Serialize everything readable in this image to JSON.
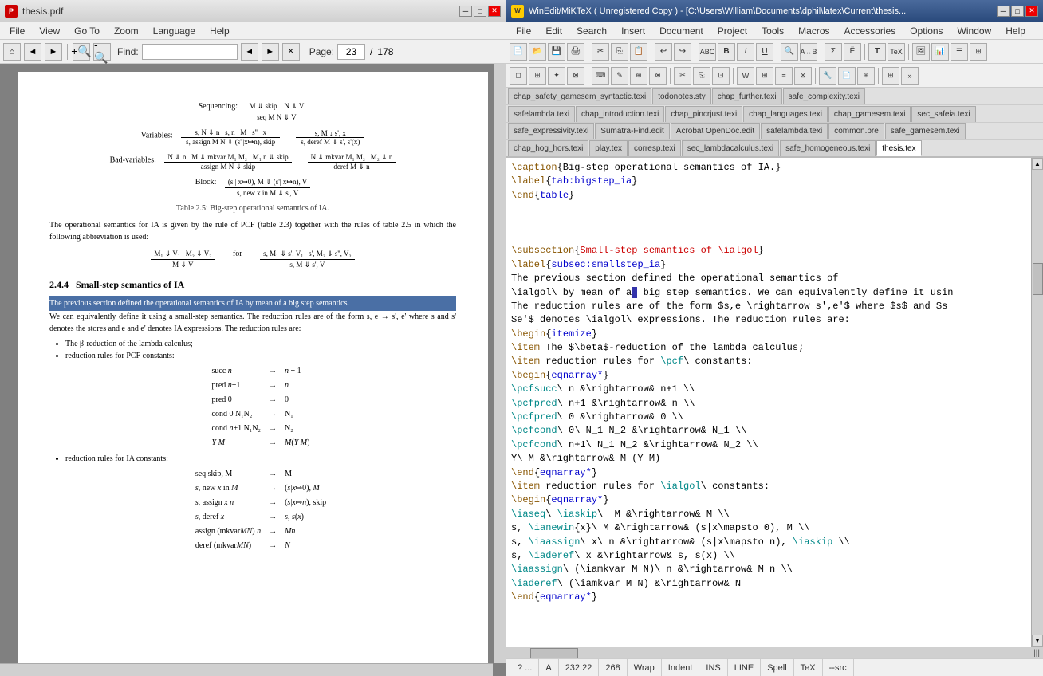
{
  "pdf": {
    "title": "thesis.pdf",
    "menubar": [
      "File",
      "View",
      "Go To",
      "Zoom",
      "Language",
      "Help"
    ],
    "toolbar": {
      "find_label": "Find:",
      "find_value": "",
      "page_current": "23",
      "page_total": "178"
    },
    "content": {
      "section": "2.4.4  Small-step semantics of IA",
      "table_caption": "Table 2.5: Big-step operational semantics of IA.",
      "highlight_text": "The previous section defined the operational semantics of IA by mean of a big step semantics.",
      "sub_text": "We can equivalently define it using a small-step semantics. The reduction rules are of the form s, e → s', e' where s and s' denotes the stores and e and e' denotes IA expressions. The reduction rules are:",
      "bullets": [
        "The β-reduction of the lambda calculus;",
        "reduction rules for PCF constants:",
        "reduction rules for IA constants:"
      ],
      "pcf_rules": [
        "succ n  →  n + 1",
        "pred n+1  →  n",
        "pred 0  →  0",
        "cond 0 N₁N₂  →  N₁",
        "cond n+1 N₁N₂  →  N₂",
        "Y M  →  M(YM)"
      ],
      "ia_rules": [
        "seq skip, M  →  M",
        "s, new x in M  →  (s|x↦0), M",
        "s, assign x n  →  (s|x↦n), skip",
        "s, deref x  →  s, s(x)",
        "assign (mkvar MN) n  →  M n",
        "deref (mkvar MN)  →  N"
      ]
    }
  },
  "editor": {
    "title": "WinEdit/MiKTeX  ( Unregistered Copy )  - [C:\\Users\\William\\Documents\\dphil\\latex\\Current\\thesis...",
    "menubar": [
      "File",
      "Edit",
      "Search",
      "Insert",
      "Document",
      "Project",
      "Tools",
      "Macros",
      "Accessories",
      "Options",
      "Window",
      "Help"
    ],
    "tabs_row1": [
      "chap_safety_gamesem_syntactic.texi",
      "todonotes.sty",
      "chap_further.texi",
      "safe_complexity.texi"
    ],
    "tabs_row2": [
      "safelambda.texi",
      "chap_introduction.texi",
      "chap_pincrjust.texi",
      "chap_languages.texi",
      "chap_gamesem.texi",
      "sec_safeia.texi"
    ],
    "tabs_row3": [
      "safe_expressivity.texi",
      "Sumatra-Find.edit",
      "Acrobat OpenDoc.edit",
      "safelambda.texi",
      "common.pre",
      "safe_gamesem.texi"
    ],
    "tabs_row4": [
      "chap_hog_hors.texi",
      "play.tex",
      "corresp.texi",
      "sec_lambdacalculus.texi",
      "safe_homogeneous.texi",
      "thesis.tex"
    ],
    "active_tab": "thesis.tex",
    "code_lines": [
      "\\caption{Big-step operational semantics of IA.}",
      "\\label{tab:bigstep_ia}",
      "\\end{table}",
      "",
      "",
      "\\subsection{Small-step semantics of \\ialgol}",
      "\\label{subsec:smallstep_ia}",
      "The previous section defined the operational semantics of",
      "\\ialgol\\ by mean of a big step semantics. We can equivalently define it usin",
      "The reduction rules are of the form $s,e \\rightarrow s',e'$ where $s$ and $s",
      "$e'$ denotes \\ialgol\\ expressions. The reduction rules are:",
      "\\begin{itemize}",
      "\\item The $\\beta$-reduction of the lambda calculus;",
      "\\item reduction rules for \\pcf\\ constants:",
      "\\begin{eqnarray*}",
      "\\pcfsucc\\ n &\\rightarrow& n+1 \\\\",
      "\\pcfpred\\ n+1 &\\rightarrow& n \\\\",
      "\\pcfpred\\ 0 &\\rightarrow& 0 \\\\",
      "\\pcfcond\\ 0\\ N_1 N_2 &\\rightarrow& N_1 \\\\",
      "\\pcfcond\\ n+1\\ N_1 N_2 &\\rightarrow& N_2 \\\\",
      "Y\\ M &\\rightarrow& M (Y M)",
      "\\end{eqnarray*}",
      "\\item reduction rules for \\ialgol\\ constants:",
      "\\begin{eqnarray*}",
      "\\iaseq\\ \\iaskip\\  M &\\rightarrow& M \\\\",
      "s, \\ianewin{x}\\ M &\\rightarrow& (s|x\\mapsto 0), M \\\\",
      "s, \\iaassign\\ x\\ n &\\rightarrow& (s|x\\mapsto n), \\iaskip \\\\",
      "s, \\iaderef\\ x &\\rightarrow& s, s(x) \\\\",
      "\\iaassign\\ (\\iamkvar M N)\\ n &\\rightarrow& M n \\\\",
      "\\iaderef\\ (\\iamkvar M N) &\\rightarrow& N",
      "\\end{eqnarray*}"
    ],
    "statusbar": {
      "seg1": "? ...",
      "seg2": "A",
      "seg3": "232:22",
      "seg4": "268",
      "seg5": "Wrap",
      "seg6": "Indent",
      "seg7": "INS",
      "seg8": "LINE",
      "seg9": "Spell",
      "seg10": "TeX",
      "seg11": "--src"
    }
  },
  "icons": {
    "minimize": "─",
    "maximize": "□",
    "close": "✕",
    "back": "◄",
    "forward": "►",
    "home": "⌂",
    "magnify_plus": "🔍",
    "magnify_minus": "🔎",
    "nav_prev": "◄",
    "nav_next": "►",
    "nav_first": "|◄",
    "nav_last": "►|"
  }
}
